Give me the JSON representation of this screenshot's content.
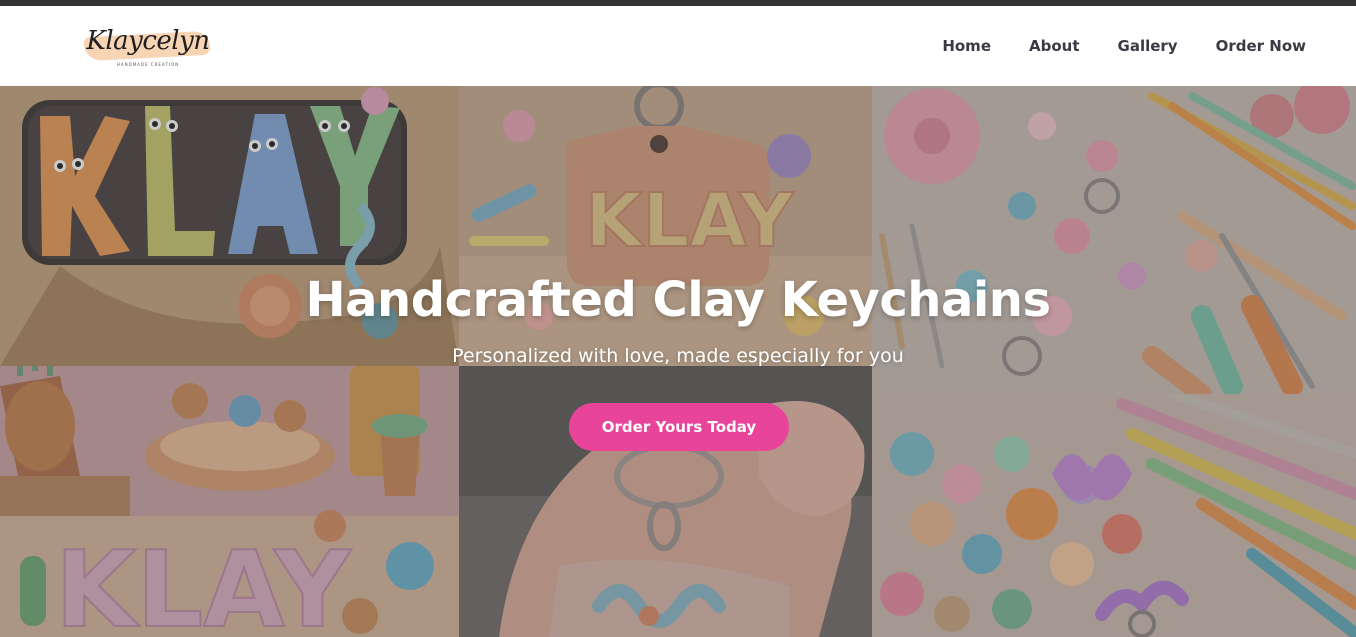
{
  "brand": {
    "logo_text": "Klaycelyn",
    "logo_tagline": "HANDMADE CREATION"
  },
  "nav": {
    "items": [
      {
        "label": "Home"
      },
      {
        "label": "About"
      },
      {
        "label": "Gallery"
      },
      {
        "label": "Order Now"
      }
    ]
  },
  "hero": {
    "title": "Handcrafted Clay Keychains",
    "subtitle": "Personalized with love, made especially for you",
    "cta_label": "Order Yours Today",
    "gallery_tiles": [
      {
        "description_icon": "klay-letters-tray-image",
        "inscription": "KLAY"
      },
      {
        "description_icon": "klay-keychain-tag-image",
        "inscription": "KLAY"
      },
      {
        "description_icon": "clay-tools-flatlay-image"
      },
      {
        "description_icon": "klay-clay-figurines-image",
        "inscription": "KLAY"
      },
      {
        "description_icon": "hand-holding-keychain-image"
      },
      {
        "description_icon": "clay-beads-pencils-image"
      }
    ]
  },
  "colors": {
    "accent": "#e8459a",
    "top_stripe": "#333333",
    "nav_text": "#3a3a44",
    "logo_swash": "#f6cda6"
  }
}
